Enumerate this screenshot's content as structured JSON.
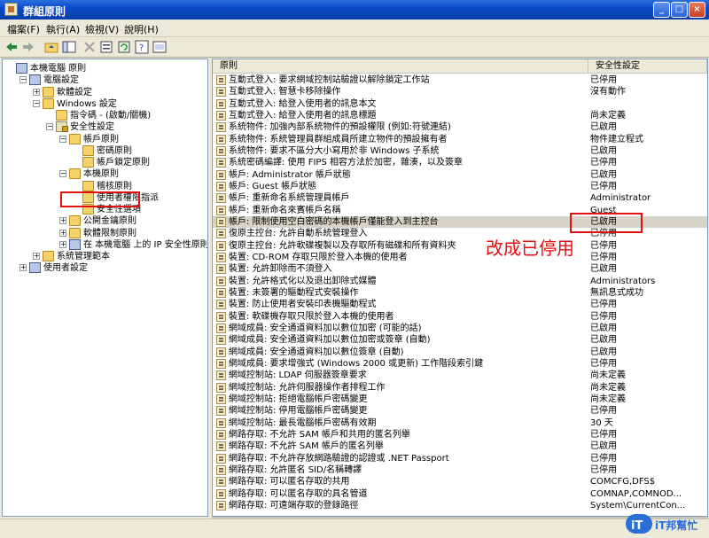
{
  "window": {
    "title": "群組原則"
  },
  "menu": [
    "檔案(F)",
    "執行(A)",
    "檢視(V)",
    "說明(H)"
  ],
  "tree": [
    {
      "label": "本機電腦 原則",
      "level": 0,
      "box": "",
      "icon": "computer"
    },
    {
      "label": "電腦設定",
      "level": 1,
      "box": "-",
      "icon": "computer"
    },
    {
      "label": "軟體設定",
      "level": 2,
      "box": "+",
      "icon": "folder"
    },
    {
      "label": "Windows 設定",
      "level": 2,
      "box": "-",
      "icon": "folder"
    },
    {
      "label": "指令碼 - (啟動/關機)",
      "level": 3,
      "box": "",
      "icon": "script"
    },
    {
      "label": "安全性設定",
      "level": 3,
      "box": "-",
      "icon": "security"
    },
    {
      "label": "帳戶原則",
      "level": 4,
      "box": "-",
      "icon": "folder"
    },
    {
      "label": "密碼原則",
      "level": 5,
      "box": "",
      "icon": "folder"
    },
    {
      "label": "帳戶鎖定原則",
      "level": 5,
      "box": "",
      "icon": "folder"
    },
    {
      "label": "本機原則",
      "level": 4,
      "box": "-",
      "icon": "folder"
    },
    {
      "label": "稽核原則",
      "level": 5,
      "box": "",
      "icon": "folder"
    },
    {
      "label": "使用者權限指派",
      "level": 5,
      "box": "",
      "icon": "folder"
    },
    {
      "label": "安全性選項",
      "level": 5,
      "box": "",
      "icon": "folder"
    },
    {
      "label": "公開金鑰原則",
      "level": 4,
      "box": "+",
      "icon": "folder"
    },
    {
      "label": "軟體限制原則",
      "level": 4,
      "box": "+",
      "icon": "folder"
    },
    {
      "label": "在 本機電腦 上的 IP 安全性原則",
      "level": 4,
      "box": "+",
      "icon": "ipsec"
    },
    {
      "label": "系統管理範本",
      "level": 2,
      "box": "+",
      "icon": "folder"
    },
    {
      "label": "使用者設定",
      "level": 1,
      "box": "+",
      "icon": "user"
    }
  ],
  "columns": {
    "policy": "原則",
    "setting": "安全性設定"
  },
  "rows": [
    {
      "policy": "互動式登入: 要求網域控制站驗證以解除鎖定工作站",
      "setting": "已停用"
    },
    {
      "policy": "互動式登入: 智慧卡移除操作",
      "setting": "沒有動作"
    },
    {
      "policy": "互動式登入: 給登入使用者的訊息本文",
      "setting": ""
    },
    {
      "policy": "互動式登入: 給登入使用者的訊息標題",
      "setting": "尚未定義"
    },
    {
      "policy": "系統物件: 加強內部系統物件的預設權限 (例如:符號連結)",
      "setting": "已啟用"
    },
    {
      "policy": "系統物件: 系統管理員群組成員所建立物件的預設擁有者",
      "setting": "物件建立程式"
    },
    {
      "policy": "系統物件: 要求不區分大小寫用於非 Windows 子系統",
      "setting": "已啟用"
    },
    {
      "policy": "系統密碼編譯: 使用 FIPS 相容方法於加密，雜湊，以及簽章",
      "setting": "已停用"
    },
    {
      "policy": "帳戶: Administrator 帳戶狀態",
      "setting": "已啟用"
    },
    {
      "policy": "帳戶: Guest 帳戶狀態",
      "setting": "已停用"
    },
    {
      "policy": "帳戶: 重新命名系統管理員帳戶",
      "setting": "Administrator"
    },
    {
      "policy": "帳戶: 重新命名來賓帳戶名稱",
      "setting": "Guest"
    },
    {
      "policy": "帳戶: 限制使用空白密碼的本機帳戶僅能登入到主控台",
      "setting": "已啟用",
      "selected": true
    },
    {
      "policy": "復原主控台: 允許自動系統管理登入",
      "setting": "已停用"
    },
    {
      "policy": "復原主控台: 允許軟碟複製以及存取所有磁碟和所有資料夾",
      "setting": "已停用"
    },
    {
      "policy": "裝置: CD-ROM 存取只限於登入本機的使用者",
      "setting": "已停用"
    },
    {
      "policy": "裝置: 允許卸除而不須登入",
      "setting": "已啟用"
    },
    {
      "policy": "裝置: 允許格式化以及退出卸除式媒體",
      "setting": "Administrators"
    },
    {
      "policy": "裝置: 未簽署的驅動程式安裝操作",
      "setting": "無訊息式成功"
    },
    {
      "policy": "裝置: 防止使用者安裝印表機驅動程式",
      "setting": "已停用"
    },
    {
      "policy": "裝置: 軟碟機存取只限於登入本機的使用者",
      "setting": "已停用"
    },
    {
      "policy": "網域成員: 安全通道資料加以數位加密 (可能的話)",
      "setting": "已啟用"
    },
    {
      "policy": "網域成員: 安全通道資料加以數位加密或簽章 (自動)",
      "setting": "已啟用"
    },
    {
      "policy": "網域成員: 安全通道資料加以數位簽章 (自動)",
      "setting": "已啟用"
    },
    {
      "policy": "網域成員: 要求增強式 (Windows 2000 或更新) 工作階段索引鍵",
      "setting": "已停用"
    },
    {
      "policy": "網域控制站: LDAP 伺服器簽章要求",
      "setting": "尚未定義"
    },
    {
      "policy": "網域控制站: 允許伺服器操作者排程工作",
      "setting": "尚未定義"
    },
    {
      "policy": "網域控制站: 拒絕電腦帳戶密碼變更",
      "setting": "尚未定義"
    },
    {
      "policy": "網域控制站: 停用電腦帳戶密碼變更",
      "setting": "已停用"
    },
    {
      "policy": "網域控制站: 最長電腦帳戶密碼有效期",
      "setting": "30 天"
    },
    {
      "policy": "網路存取: 不允許 SAM 帳戶和共用的匿名列舉",
      "setting": "已停用"
    },
    {
      "policy": "網路存取: 不允許 SAM 帳戶的匿名列舉",
      "setting": "已啟用"
    },
    {
      "policy": "網路存取: 不允許存放網路驗證的認證或 .NET Passport",
      "setting": "已停用"
    },
    {
      "policy": "網路存取: 允許匿名 SID/名稱轉譯",
      "setting": "已停用"
    },
    {
      "policy": "網路存取: 可以匿名存取的共用",
      "setting": "COMCFG,DFS$"
    },
    {
      "policy": "網路存取: 可以匿名存取的具名管道",
      "setting": "COMNAP,COMNOD..."
    },
    {
      "policy": "網路存取: 可遠端存取的登錄路徑",
      "setting": "System\\CurrentCon..."
    }
  ],
  "annotation": {
    "text": "改成已停用",
    "color": "#e01010"
  },
  "watermark": {
    "text": "iT邦幫忙"
  }
}
